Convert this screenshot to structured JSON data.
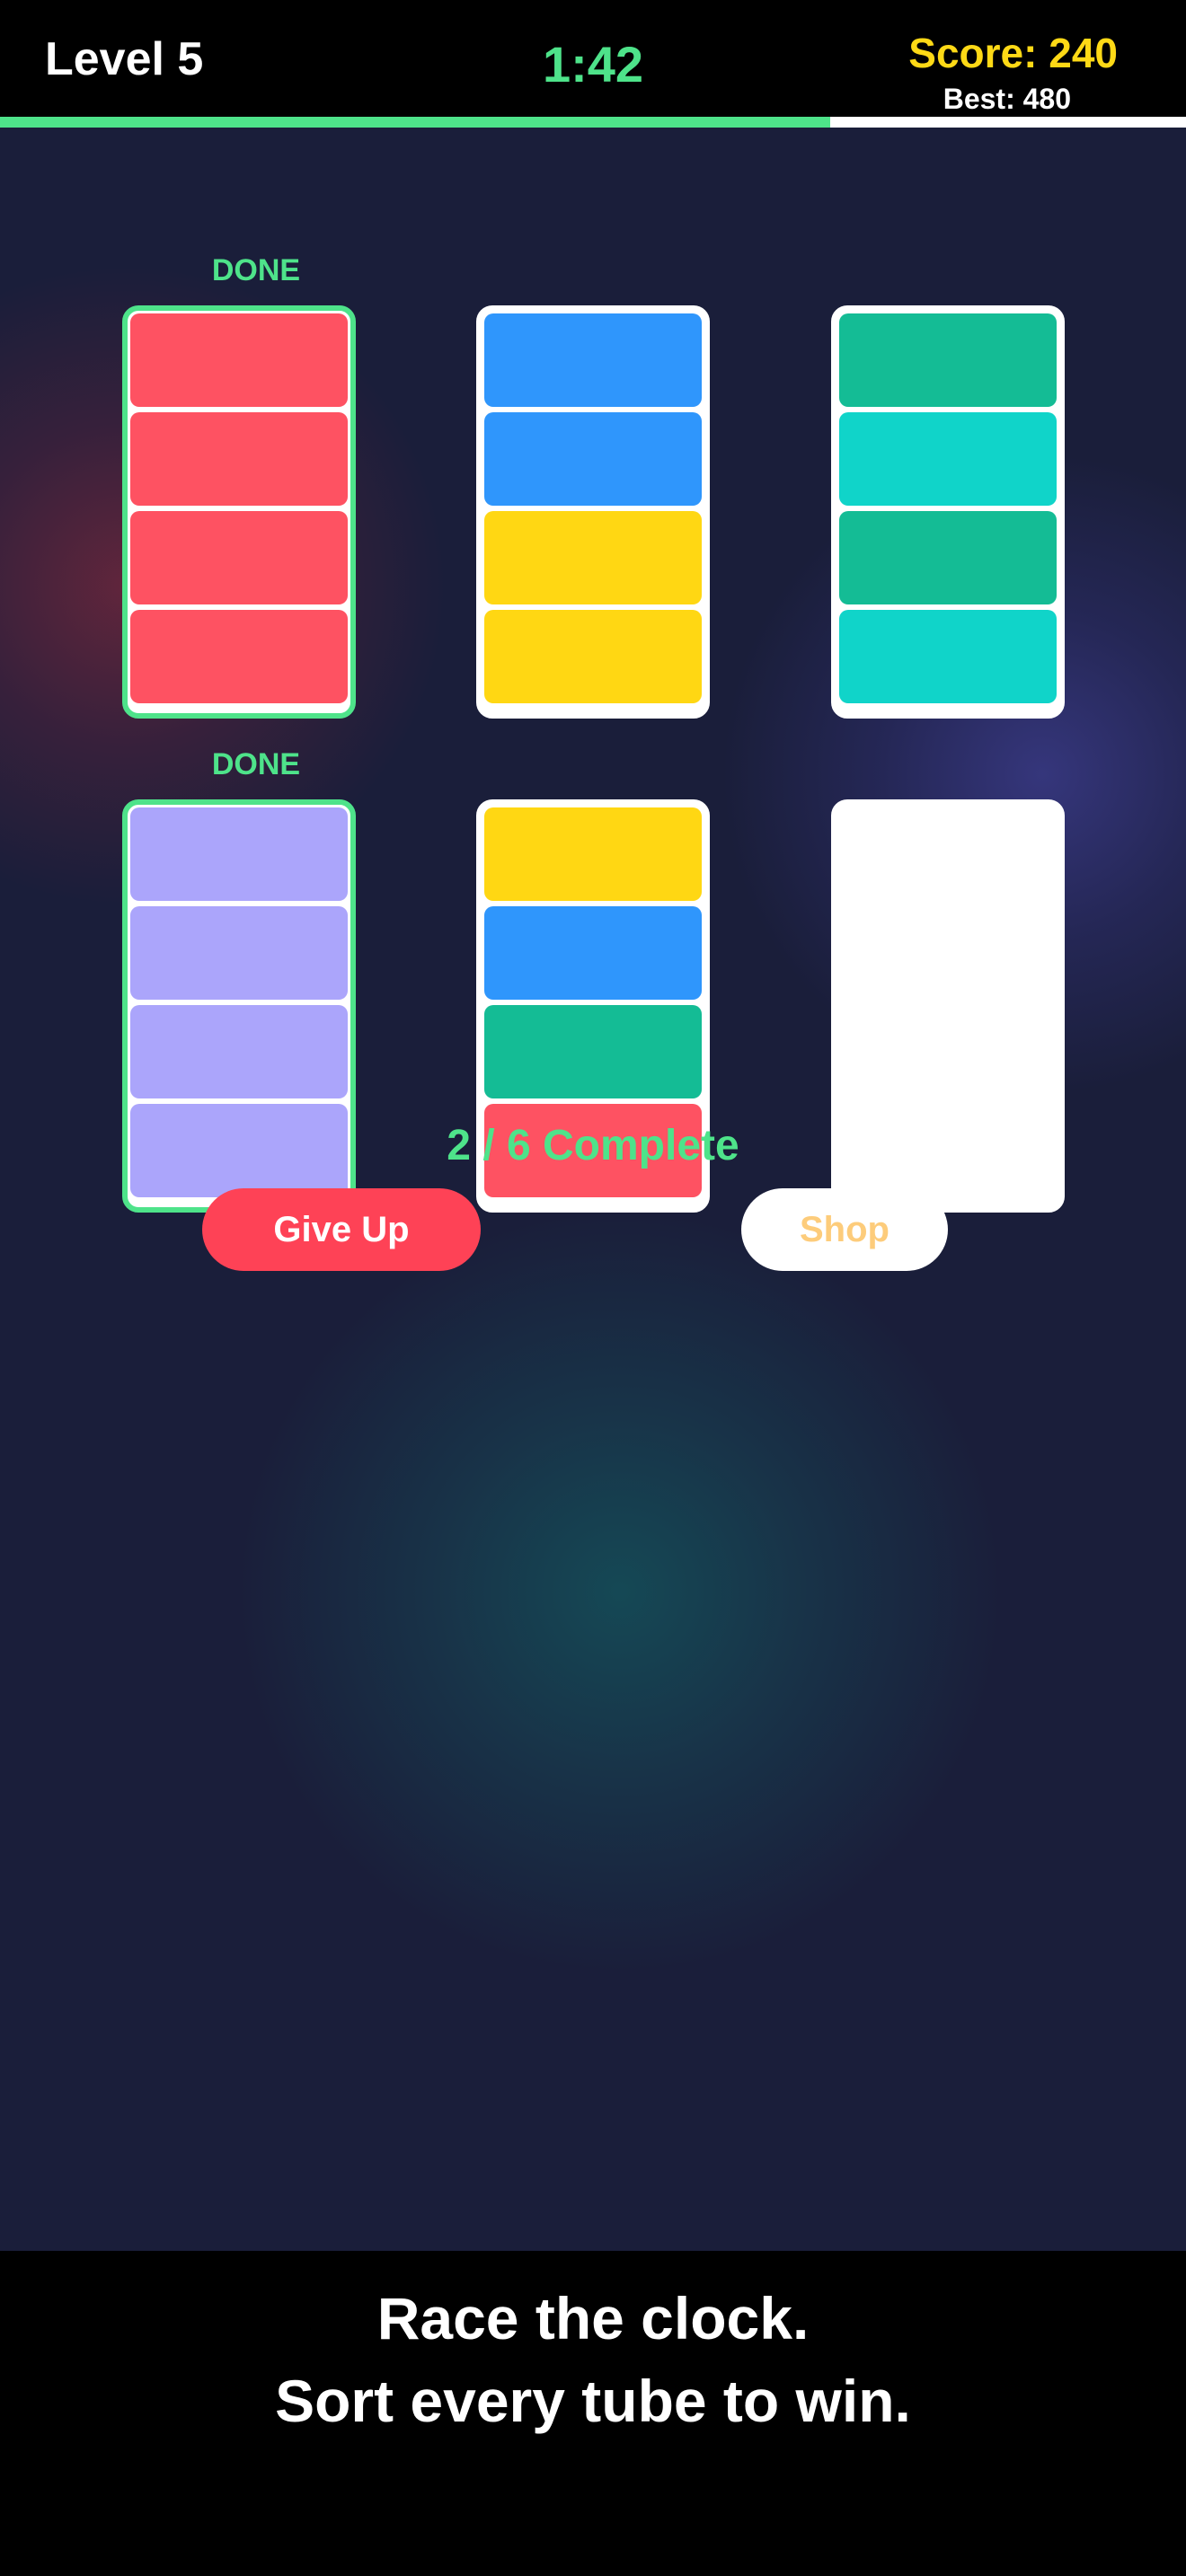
{
  "header": {
    "level_label": "Level 5",
    "timer": "1:42",
    "score": "Score: 240",
    "best": "Best: 480",
    "time_remaining_fraction": 0.7
  },
  "colors": {
    "red": "#fe5262",
    "blue": "#2f96fc",
    "yellow": "#ffd713",
    "green": "#14bc95",
    "cyan": "#10d4c9",
    "lavender": "#aba5fb",
    "done_green": "#4ee38a",
    "score_yellow": "#fed916",
    "giveup_red": "#fe4256",
    "shop_text": "#fdcc7b",
    "board_bg": "#1a1e3a"
  },
  "tubes": [
    {
      "done": true,
      "done_label": "DONE",
      "segments": [
        "red",
        "red",
        "red",
        "red"
      ]
    },
    {
      "done": false,
      "done_label": "",
      "segments": [
        "blue",
        "blue",
        "yellow",
        "yellow"
      ]
    },
    {
      "done": false,
      "done_label": "",
      "segments": [
        "green",
        "cyan",
        "green",
        "cyan"
      ]
    },
    {
      "done": true,
      "done_label": "DONE",
      "segments": [
        "lavender",
        "lavender",
        "lavender",
        "lavender"
      ]
    },
    {
      "done": false,
      "done_label": "",
      "segments": [
        "yellow",
        "blue",
        "green",
        "red"
      ]
    },
    {
      "done": false,
      "done_label": "",
      "segments": []
    }
  ],
  "status": {
    "progress_text": "2 / 6 Complete"
  },
  "actions": {
    "give_up_label": "Give Up",
    "shop_label": "Shop"
  },
  "footer": {
    "tagline_line1": "Race the clock.",
    "tagline_line2": "Sort every tube to win."
  }
}
